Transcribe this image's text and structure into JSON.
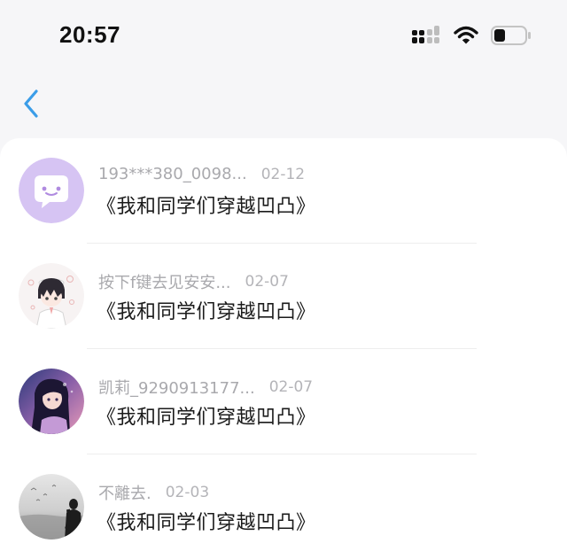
{
  "status_bar": {
    "time": "20:57",
    "icons": [
      "signal-icon",
      "wifi-icon",
      "battery-icon"
    ]
  },
  "nav": {
    "back_icon": "chevron-left-icon",
    "accent_color": "#3b9de8"
  },
  "items": [
    {
      "name": "193***380_0098...",
      "date": "02-12",
      "work": "《我和同学们穿越凹凸》",
      "avatar": "chat-bubble-avatar"
    },
    {
      "name": "按下f键去见安安...",
      "date": "02-07",
      "work": "《我和同学们穿越凹凸》",
      "avatar": "anime-boy-avatar"
    },
    {
      "name": "凯莉_9290913177...",
      "date": "02-07",
      "work": "《我和同学们穿越凹凸》",
      "avatar": "anime-girl-avatar"
    },
    {
      "name": "不離去.",
      "date": "02-03",
      "work": "《我和同学们穿越凹凸》",
      "avatar": "seaside-silhouette-avatar"
    }
  ]
}
